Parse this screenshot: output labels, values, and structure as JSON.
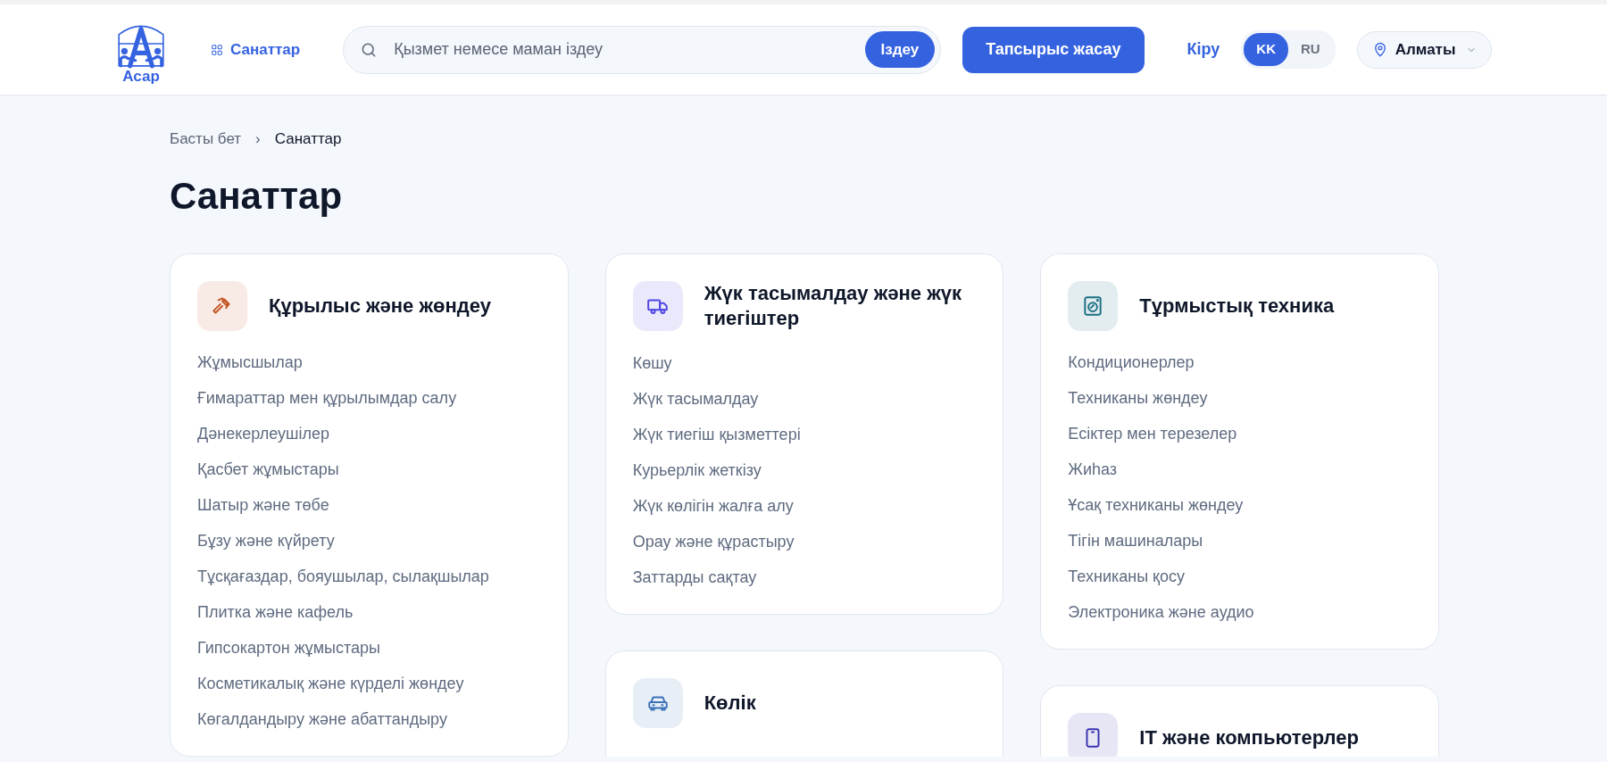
{
  "header": {
    "logo_text": "Асар",
    "categories_link": "Санаттар",
    "search": {
      "placeholder": "Қызмет немесе маман іздеу",
      "button": "Іздеу"
    },
    "order_button": "Тапсырыс жасау",
    "login_link": "Кіру",
    "languages": [
      {
        "label": "KK",
        "selected": true
      },
      {
        "label": "RU",
        "selected": false
      }
    ],
    "city": "Алматы"
  },
  "breadcrumb": [
    {
      "label": "Басты бет",
      "current": false
    },
    {
      "label": "Санаттар",
      "current": true
    }
  ],
  "breadcrumb_separator": "›",
  "title": "Санаттар",
  "columns": [
    [
      {
        "kind": "hammer",
        "color": "#c2531f",
        "title": "Құрылыс және жөндеу",
        "items": [
          "Жұмысшылар",
          "Ғимараттар мен құрылымдар салу",
          "Дәнекерлеушілер",
          "Қасбет жұмыстары",
          "Шатыр және төбе",
          "Бұзу және күйрету",
          "Тұсқағаздар, бояушылар, сылақшылар",
          "Плитка және кафель",
          "Гипсокартон жұмыстары",
          "Косметикалық және күрделі жөндеу",
          "Көгалдандыру және абаттандыру"
        ]
      }
    ],
    [
      {
        "kind": "truck",
        "color": "#4f46e5",
        "title": "Жүк тасымалдау және жүк тиегіштер",
        "items": [
          "Көшу",
          "Жүк тасымалдау",
          "Жүк тиегіш қызметтері",
          "Курьерлік жеткізу",
          "Жүк көлігін жалға алу",
          "Орау және құрастыру",
          "Заттарды сақтау"
        ]
      },
      {
        "kind": "car",
        "color": "#3a72b8",
        "title": "Көлік"
      }
    ],
    [
      {
        "kind": "washer",
        "color": "#1b6f84",
        "title": "Тұрмыстық техника",
        "items": [
          "Кондиционерлер",
          "Техниканы жөндеу",
          "Есіктер мен терезелер",
          "Жиһаз",
          "Ұсақ техниканы жөндеу",
          "Тігін машиналары",
          "Техниканы қосу",
          "Электроника және аудио"
        ]
      },
      {
        "kind": "tablet",
        "color": "#3b35b0",
        "title": "IT және компьютерлер"
      }
    ]
  ]
}
